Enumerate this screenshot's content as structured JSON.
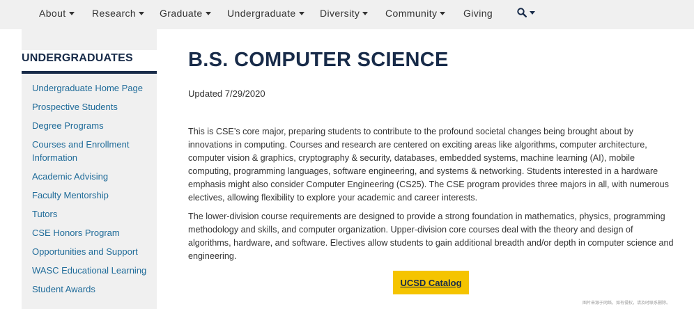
{
  "nav": {
    "items": [
      "About",
      "Research",
      "Graduate",
      "Undergraduate",
      "Diversity",
      "Community",
      "Giving"
    ],
    "search_icon": "search-icon"
  },
  "sidebar": {
    "heading": "UNDERGRADUATES",
    "links": [
      "Undergraduate Home Page",
      "Prospective Students",
      "Degree Programs",
      "Courses and Enrollment Information",
      "Academic Advising",
      "Faculty Mentorship",
      "Tutors",
      "CSE Honors Program",
      "Opportunities and Support",
      "WASC Educational Learning",
      "Student Awards"
    ]
  },
  "main": {
    "title": "B.S. COMPUTER SCIENCE",
    "updated": "Updated 7/29/2020",
    "paragraph1": "This is CSE’s core major, preparing students to contribute to the profound societal changes being brought about by innovations in computing.  Courses and research are centered on exciting areas like algorithms, computer architecture, computer vision & graphics, cryptography & security, databases, embedded systems, machine learning (AI), mobile computing, programming languages, software engineering, and systems & networking. Students interested in a hardware emphasis might also consider Computer Engineering (CS25).  The CSE program provides three majors in all, with numerous electives, allowing flexibility to explore your academic and career interests.",
    "paragraph2": "The lower-division course requirements are designed to provide a strong foundation in mathematics, physics, programming methodology and skills, and computer organization. Upper-division core courses deal with the theory and design of algorithms, hardware, and software. Electives allow students to gain additional breadth and/or depth in computer science and engineering.",
    "cta_label": "UCSD Catalog"
  },
  "watermark": "图片来源于网络，如有侵权，请及时联系删除。",
  "colors": {
    "navy": "#182b49",
    "link": "#1f6b99",
    "gold": "#f5c400",
    "gray_bg": "#f0f0f0"
  }
}
